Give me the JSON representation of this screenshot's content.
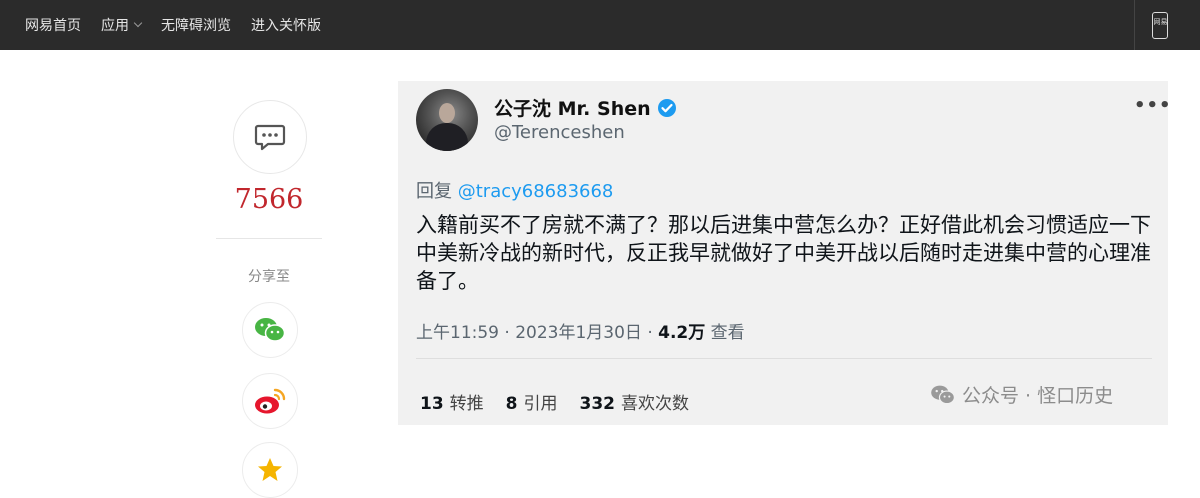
{
  "topbar": {
    "nav": [
      "网易首页",
      "应用",
      "无障碍浏览",
      "进入关怀版"
    ],
    "mobile_label": "网易"
  },
  "side": {
    "comment_count": "7566",
    "share_label": "分享至",
    "share_targets": [
      "wechat-icon",
      "weibo-icon",
      "qzone-icon"
    ]
  },
  "tweet": {
    "display_name": "公子沈 Mr. Shen",
    "handle": "@Terenceshen",
    "more": "•••",
    "reply_prefix": "回复",
    "reply_to": "@tracy68683668",
    "text": "入籍前买不了房就不满了？那以后进集中营怎么办？正好借此机会习惯适应一下中美新冷战的新时代，反正我早就做好了中美开战以后随时走进集中营的心理准备了。",
    "meta_time": "上午11:59 · 2023年1月30日 · ",
    "meta_views": "4.2万",
    "meta_views_label": " 查看",
    "retweets_count": "13",
    "retweets_label": "转推",
    "quotes_count": "8",
    "quotes_label": "引用",
    "likes_count": "332",
    "likes_label": "喜欢次数",
    "watermark": "公众号 · 怪口历史"
  },
  "colors": {
    "topbar_bg": "#2b2b2b",
    "count_red": "#c1272d",
    "link_blue": "#1d9bf0"
  }
}
